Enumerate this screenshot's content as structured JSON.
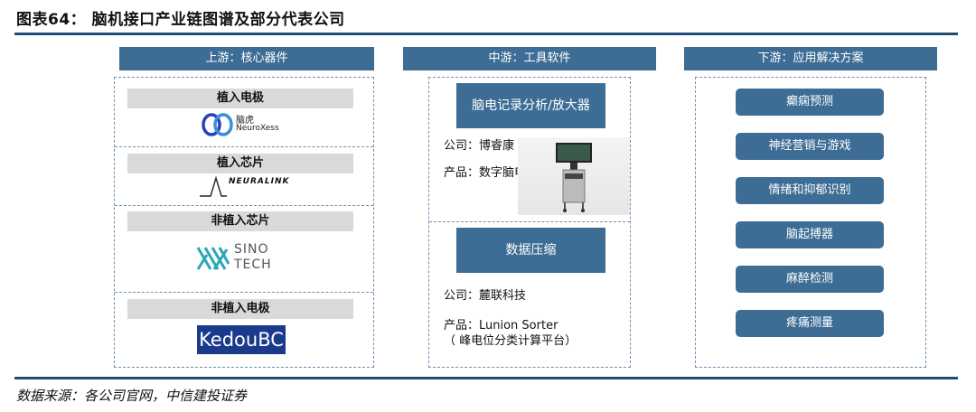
{
  "title": "图表64：  脑机接口产业链图谱及部分代表公司",
  "source": "数据来源：各公司官网，中信建投证券",
  "upstream": {
    "header": "上游：核心器件",
    "items": [
      {
        "label": "植入电极",
        "logo_text_cn": "脑虎",
        "logo_text_en": "NeuroXess"
      },
      {
        "label": "植入芯片",
        "logo_text": "NEURALINK"
      },
      {
        "label": "非植入芯片",
        "logo_text_1": "SINO",
        "logo_text_2": "TECH"
      },
      {
        "label": "非植入电极",
        "logo_text": "KedouBC"
      }
    ]
  },
  "midstream": {
    "header": "中游：工具软件",
    "block1": {
      "title": "脑电记录分析/放大器",
      "company": "公司：博睿康",
      "product": "产品：数字脑电图机"
    },
    "block2": {
      "title": "数据压缩",
      "company": "公司：麓联科技",
      "product": "产品：Lunion Sorter",
      "product2": "（ 峰电位分类计算平台）"
    }
  },
  "downstream": {
    "header": "下游：应用解决方案",
    "items": [
      "癫痫预测",
      "神经营销与游戏",
      "情绪和抑郁识别",
      "脑起搏器",
      "麻醉检测",
      "疼痛测量"
    ]
  },
  "colors": {
    "accent": "#3d6d95",
    "rule": "#1f4e79",
    "label_bg": "#d9d9d9"
  }
}
